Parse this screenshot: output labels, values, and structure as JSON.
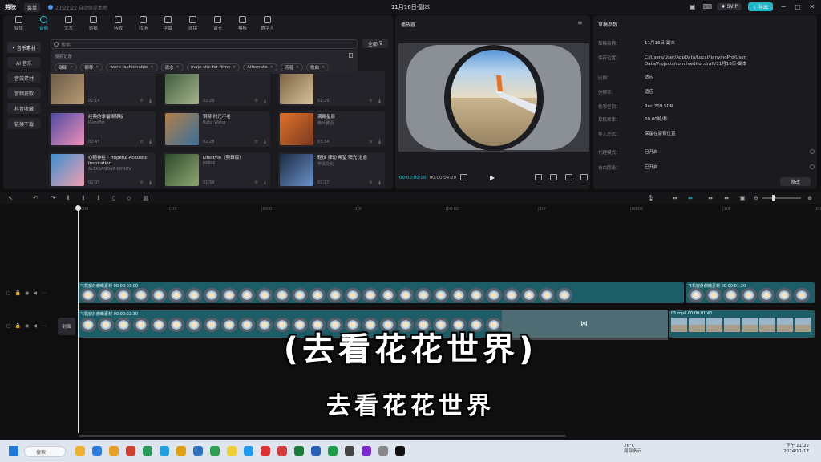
{
  "titlebar": {
    "app_name": "剪映",
    "menu": "菜单",
    "save_status": "23:22:22 自动保存本地",
    "title": "11月16日-副本",
    "svip": "SVIP",
    "export": "导出"
  },
  "toolbar": {
    "items": [
      {
        "label": "媒体"
      },
      {
        "label": "音频"
      },
      {
        "label": "文本"
      },
      {
        "label": "贴纸"
      },
      {
        "label": "特效"
      },
      {
        "label": "转场"
      },
      {
        "label": "字幕"
      },
      {
        "label": "滤镜"
      },
      {
        "label": "调节"
      },
      {
        "label": "模板"
      },
      {
        "label": "数字人"
      }
    ]
  },
  "sidebar": {
    "items": [
      {
        "label": "• 音乐素材"
      },
      {
        "label": "AI 音乐"
      },
      {
        "label": "音效素材"
      },
      {
        "label": "音频提取"
      },
      {
        "label": "抖音收藏"
      },
      {
        "label": "链接下载"
      }
    ]
  },
  "search": {
    "placeholder": "搜索",
    "all_button": "全部"
  },
  "history": {
    "label": "搜索记录",
    "chips": [
      "甜甜",
      "钢琴",
      "work fashionable",
      "流水",
      "maje stic for films",
      "Alternate",
      "清唱",
      "歌曲"
    ]
  },
  "cards": [
    {
      "title": "",
      "artist": "",
      "duration": "02:14"
    },
    {
      "title": "",
      "artist": "",
      "duration": "02:26"
    },
    {
      "title": "",
      "artist": "",
      "duration": "01:29"
    },
    {
      "title": "经典的幸福钢琴板",
      "artist": "PianoFei",
      "duration": "02:43"
    },
    {
      "title": "铜琴 时光不老",
      "artist": "Ruby Wang",
      "duration": "02:28"
    },
    {
      "title": "满眼星辰",
      "artist": "微叶彼羽",
      "duration": "03:34"
    },
    {
      "title": "心随神往 - Hopeful Acoustic Inspiration",
      "artist": "ALEKSANDAR KIPROV",
      "duration": "02:03"
    },
    {
      "title": "Lifestyle（剪辑版）",
      "artist": "HMMK",
      "duration": "01:59"
    },
    {
      "title": "轻快 律动 希望 阳光 治愈",
      "artist": "学清文化",
      "duration": "02:17"
    }
  ],
  "player": {
    "title": "播放器",
    "current_time": "00:00:00:00",
    "duration": "00:00:04:20"
  },
  "params": {
    "title": "草稿参数",
    "rows": [
      {
        "key": "草稿名称：",
        "value": "11月16日-副本"
      },
      {
        "key": "保存位置：",
        "value": "C:/Users/User/AppData/Local/JianyingPro/User Data/Projects/com.lveditor.draft/11月16日-副本"
      },
      {
        "key": "比例：",
        "value": "适应"
      },
      {
        "key": "分辨率：",
        "value": "适应"
      },
      {
        "key": "色彩空间：",
        "value": "Rec.709 SDR"
      },
      {
        "key": "草稿帧率：",
        "value": "60.00帧/秒"
      },
      {
        "key": "导入方式：",
        "value": "保留在原有位置"
      },
      {
        "key": "代理模式：",
        "value": "已开启"
      },
      {
        "key": "自由层级：",
        "value": "已开启"
      }
    ],
    "modify_button": "修改"
  },
  "timeline": {
    "ticks": [
      "00:00",
      "|10f",
      "|00:01",
      "|10f",
      "|00:02",
      "|10f",
      "|00:03",
      "|10f",
      "|00:04"
    ],
    "track1": [
      {
        "label": "飞机窗外俯瞰素材  00:00:03:00"
      },
      {
        "label": "飞机窗外俯瞰素材  00:00:01:20"
      }
    ],
    "track2": [
      {
        "label": "飞机窗外俯瞰素材  00:00:02:30"
      },
      {
        "label": "05.mp4  00:00:01:40"
      }
    ],
    "cover_label": "封面",
    "subtitle_main": "(去看花花世界)",
    "subtitle_sub": "去看花花世界"
  },
  "taskbar": {
    "search_label": "搜索",
    "weather_temp": "26°C",
    "weather_desc": "局部多云",
    "time": "下午 11:22",
    "date": "2024/11/17"
  }
}
